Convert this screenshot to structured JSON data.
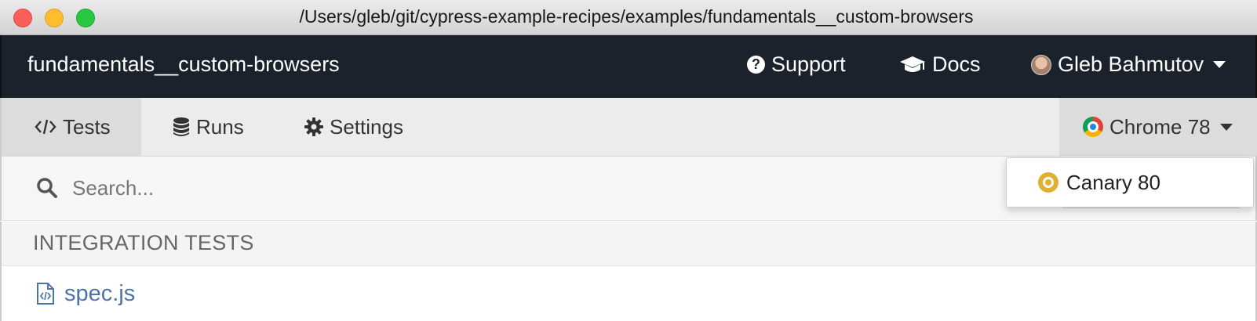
{
  "window": {
    "title": "/Users/gleb/git/cypress-example-recipes/examples/fundamentals__custom-browsers"
  },
  "navbar": {
    "project_name": "fundamentals__custom-browsers",
    "support_label": "Support",
    "docs_label": "Docs",
    "user_name": "Gleb Bahmutov"
  },
  "tabs": [
    {
      "label": "Tests",
      "icon": "code-icon",
      "active": true
    },
    {
      "label": "Runs",
      "icon": "database-icon",
      "active": false
    },
    {
      "label": "Settings",
      "icon": "gear-icon",
      "active": false
    }
  ],
  "browser": {
    "selected": "Chrome 78",
    "options": [
      {
        "label": "Canary 80",
        "icon": "canary-icon"
      }
    ]
  },
  "search": {
    "placeholder": "Search...",
    "value": ""
  },
  "specs": {
    "section_title": "INTEGRATION TESTS",
    "items": [
      {
        "name": "spec.js"
      }
    ]
  },
  "colors": {
    "navbar_bg": "#1c222c",
    "link_blue": "#4e73a8",
    "canary_yellow": "#e0b030"
  }
}
